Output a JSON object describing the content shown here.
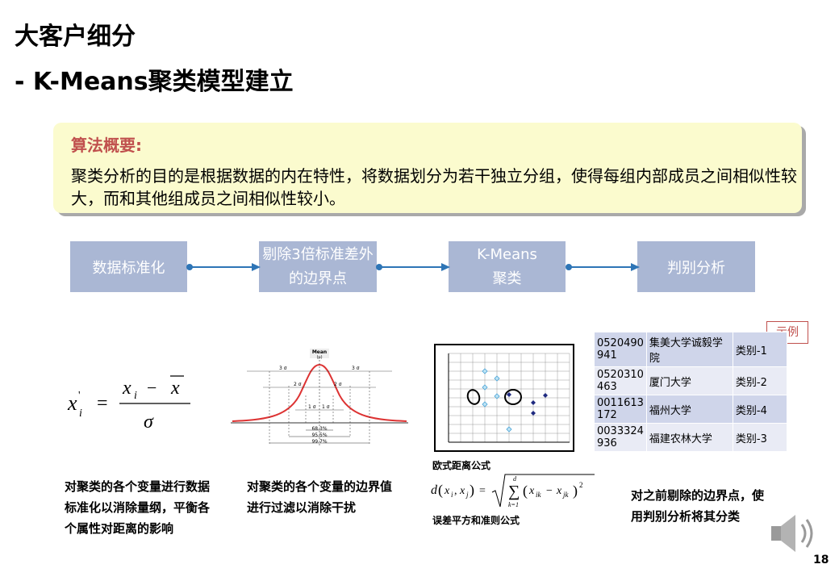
{
  "header": {
    "title": "大客户细分",
    "subtitle": "- K-Means聚类模型建立"
  },
  "summary": {
    "heading": "算法概要:",
    "body": "聚类分析的目的是根据数据的内在特性，将数据划分为若干独立分组，使得每组内部成员之间相似性较大，而和其他组成员之间相似性较小。"
  },
  "flow": {
    "steps": [
      {
        "label": "数据标准化"
      },
      {
        "label": "剔除3倍标准差外的边界点"
      },
      {
        "label": "K-Means聚类"
      },
      {
        "label": "判别分析"
      }
    ]
  },
  "captions": {
    "standardize": "对聚类的各个变量进行数据标准化以消除量纲，平衡各个属性对距离的影响",
    "filter": "对聚类的各个变量的边界值进行过滤以消除干扰",
    "discriminant": "对之前剔除的边界点，使用判别分析将其分类"
  },
  "normal_curve": {
    "mean_label": "Mean",
    "mu_label": "(μ)",
    "pct_1": "68.3%",
    "pct_2": "95.5%",
    "pct_3": "99.7%",
    "sigma_1": "1 σ",
    "sigma_2": "2 σ",
    "sigma_3": "3 σ"
  },
  "kmeans": {
    "euclid_label": "欧式距离公式",
    "sse_label": "误差平方和准则公式"
  },
  "example": {
    "tag": "示例",
    "rows": [
      {
        "id": "0520490 941",
        "name": "集美大学诚毅学院",
        "cls": "类别-1"
      },
      {
        "id": "0520310 463",
        "name": "厦门大学",
        "cls": "类别-2"
      },
      {
        "id": "0011613 172",
        "name": "福州大学",
        "cls": "类别-4"
      },
      {
        "id": "0033324 936",
        "name": "福建农林大学",
        "cls": "类别-3"
      }
    ]
  },
  "page": {
    "number": "18"
  },
  "colors": {
    "accent": "#c0504d",
    "box": "#aab7d4",
    "arrow": "#2e75b6",
    "summary_bg": "#fbfbce"
  }
}
